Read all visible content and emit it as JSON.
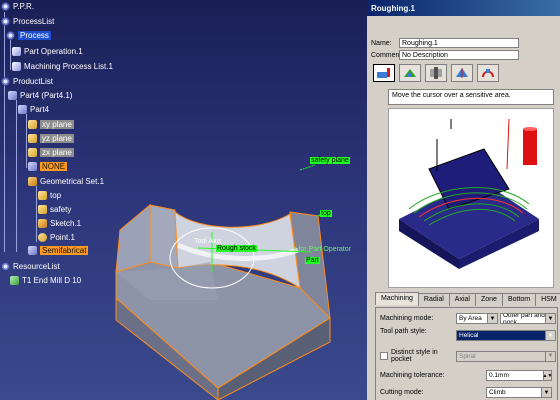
{
  "tree": {
    "root": "P.P.R.",
    "process_list": "ProcessList",
    "process": "Process",
    "part_operation": "Part Operation.1",
    "machining_process_list": "Machining Process List.1",
    "product_list": "ProductList",
    "part4_instance": "Part4 (Part4.1)",
    "part4": "Part4",
    "xy_plane": "xy plane",
    "yz_plane": "yz plane",
    "zx_plane": "zx plane",
    "none_body": "NONE",
    "geometrical_set": "Geometrical Set.1",
    "top": "top",
    "safety": "safety",
    "sketch": "Sketch.1",
    "point": "Point.1",
    "semifabricat": "Semifabricat",
    "resource_list": "ResourceList",
    "tool": "T1 End Mill D 10"
  },
  "scene": {
    "safety_plane_tag": "safety plane",
    "top_tag": "top",
    "tool_axis_tag": "Tool Axis",
    "rough_stock_tag": "Rough stock",
    "part_operator_tag": "s for Part Operator",
    "part_tag": "Part"
  },
  "dialog": {
    "title": "Roughing.1",
    "name_label": "Name:",
    "name_value": "Roughing.1",
    "comment_label": "Comment:",
    "comment_value": "No Description",
    "hint": "Move the cursor over a sensitive area.",
    "tabs": [
      "Machining",
      "Radial",
      "Axial",
      "Zone",
      "Bottom",
      "HSM"
    ],
    "machining_mode_label": "Machining mode:",
    "machining_mode_value": "By Area",
    "machining_mode_value2": "Outer part and pock",
    "tool_path_style_label": "Tool path style:",
    "tool_path_style_value": "Helical",
    "distinct_style_label": "Distinct style in pocket",
    "distinct_style_value": "Spiral",
    "tolerance_label": "Machining tolerance:",
    "tolerance_value": "0.1mm",
    "cutting_mode_label": "Cutting mode:",
    "cutting_mode_value": "Climb"
  },
  "colors": {
    "viewport_top": "#1a1f55",
    "viewport_bottom": "#3a4a8c",
    "titlebar": "#0a246a",
    "highlight_blue": "#1f4fd0",
    "highlight_orange": "#ff9a1f",
    "tag_green": "#22ff22",
    "part_face": "#8e94a8",
    "edge_orange": "#ff8c1a"
  }
}
